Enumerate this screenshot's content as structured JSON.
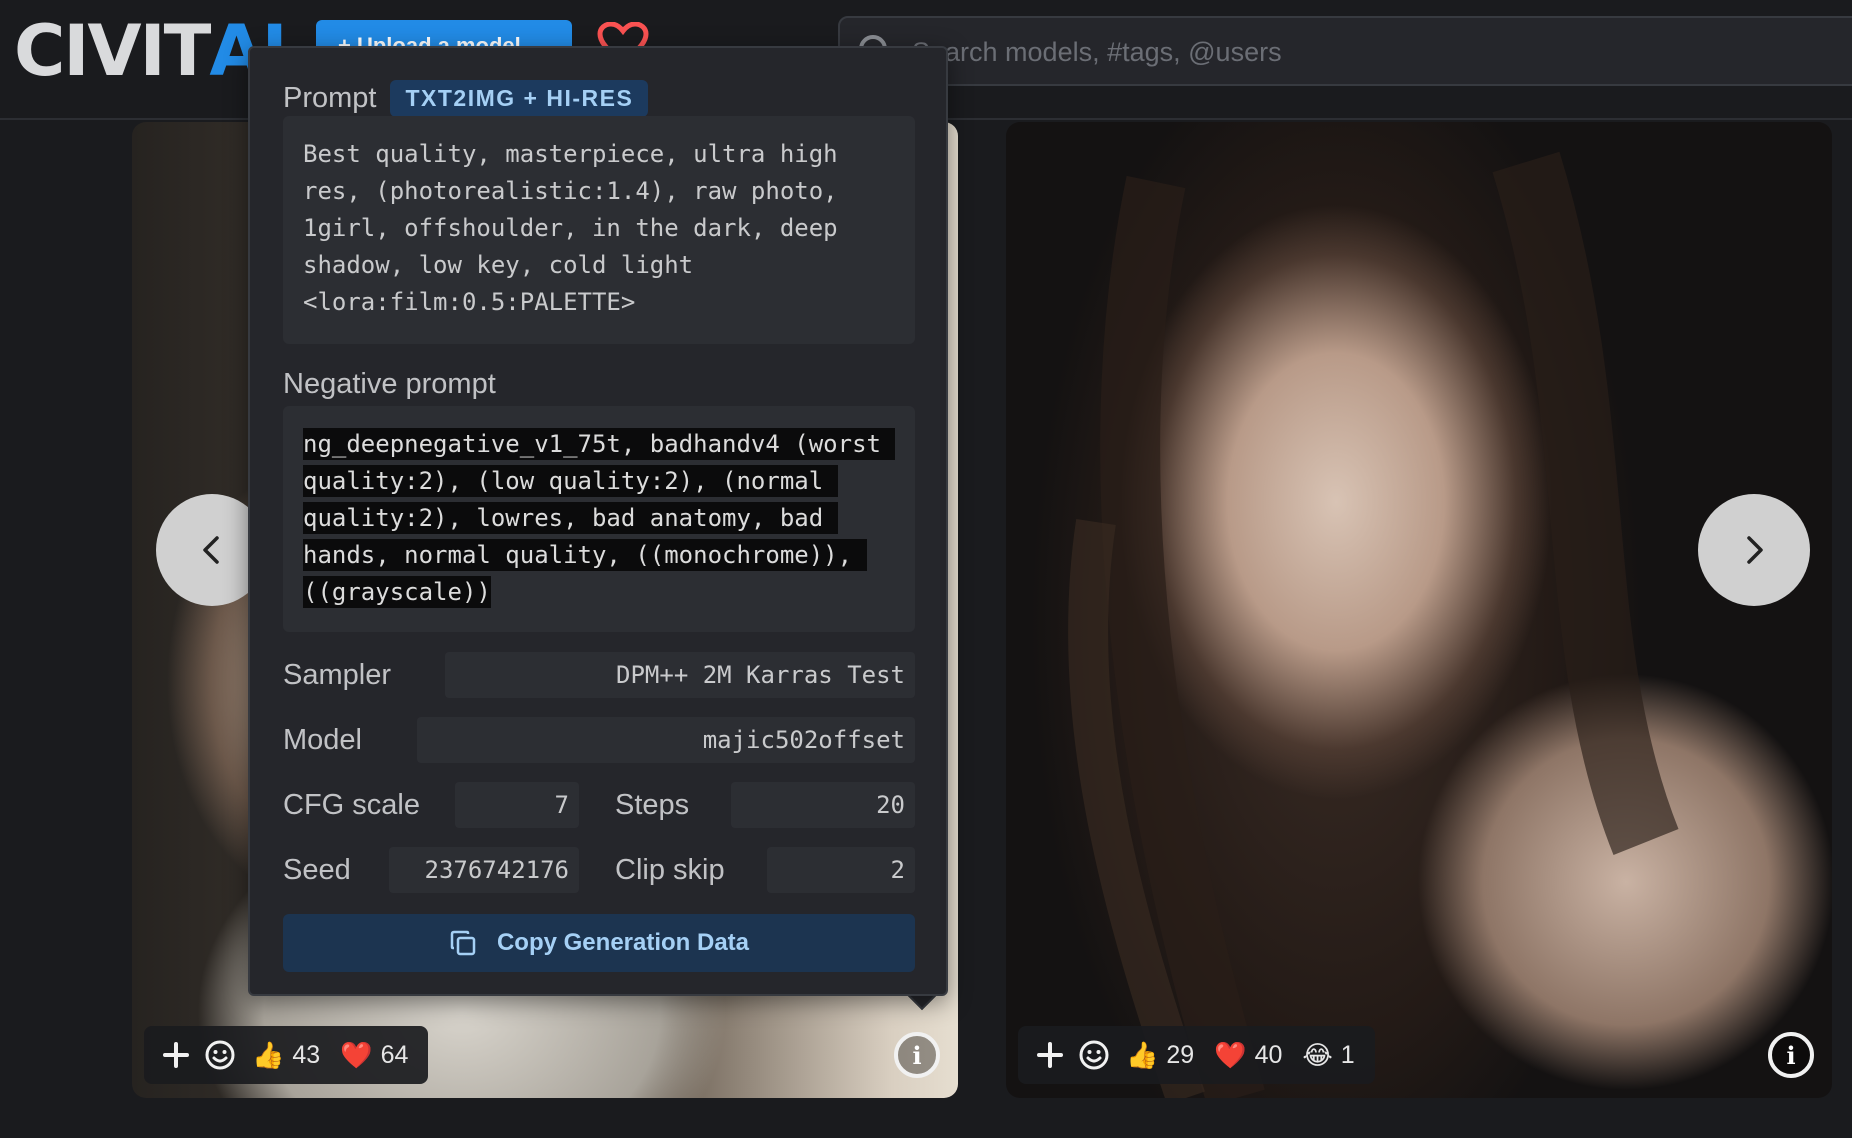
{
  "header": {
    "logo_main": "CIVIT",
    "logo_accent": "AI",
    "upload_label": "+ Upload a model",
    "search_placeholder": "Search models, #tags, @users"
  },
  "popover": {
    "prompt_label": "Prompt",
    "prompt_badge": "TXT2IMG + HI-RES",
    "prompt_text": "Best quality, masterpiece, ultra high res, (photorealistic:1.4), raw photo, 1girl, offshoulder, in the dark, deep shadow, low key, cold light <lora:film:0.5:PALETTE>",
    "negative_label": "Negative prompt",
    "negative_text": "ng_deepnegative_v1_75t, badhandv4 (worst quality:2), (low quality:2), (normal quality:2), lowres, bad anatomy, bad hands, normal quality, ((monochrome)), ((grayscale))",
    "sampler_label": "Sampler",
    "sampler_value": "DPM++ 2M Karras Test",
    "model_label": "Model",
    "model_value": "majic502offset",
    "cfg_label": "CFG scale",
    "cfg_value": "7",
    "steps_label": "Steps",
    "steps_value": "20",
    "seed_label": "Seed",
    "seed_value": "2376742176",
    "clipskip_label": "Clip skip",
    "clipskip_value": "2",
    "copy_label": "Copy Generation Data"
  },
  "cards": [
    {
      "reactions": [
        {
          "emoji": "👍",
          "count": "43"
        },
        {
          "emoji": "❤️",
          "count": "64"
        }
      ]
    },
    {
      "reactions": [
        {
          "emoji": "👍",
          "count": "29"
        },
        {
          "emoji": "❤️",
          "count": "40"
        },
        {
          "emoji": "😂",
          "count": "1"
        }
      ]
    }
  ],
  "icons": {
    "accent": "#228be6",
    "heart_outline": "#fa5252"
  }
}
